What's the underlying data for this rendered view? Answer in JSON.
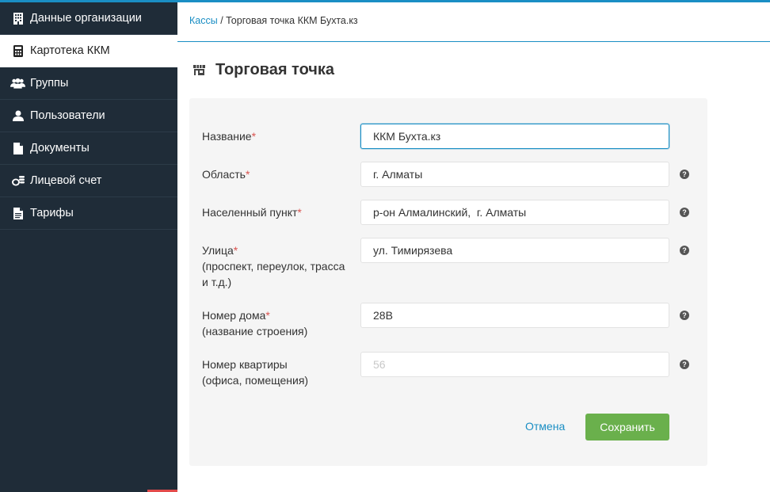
{
  "sidebar": {
    "items": [
      {
        "label": "Данные организации",
        "icon": "building-icon"
      },
      {
        "label": "Картотека ККМ",
        "icon": "calculator-icon",
        "active": true
      },
      {
        "label": "Группы",
        "icon": "users-group-icon"
      },
      {
        "label": "Пользователи",
        "icon": "user-icon"
      },
      {
        "label": "Документы",
        "icon": "document-icon"
      },
      {
        "label": "Лицевой счет",
        "icon": "coins-icon"
      },
      {
        "label": "Тарифы",
        "icon": "tariff-document-icon"
      }
    ]
  },
  "breadcrumb": {
    "link": "Кассы",
    "separator": " / ",
    "current": "Торговая точка ККМ Бухта.кз"
  },
  "page": {
    "title": "Торговая точка",
    "icon": "store-icon"
  },
  "form": {
    "name": {
      "label": "Название",
      "required": "*",
      "value": "ККМ Бухта.кз"
    },
    "region": {
      "label": "Область",
      "required": "*",
      "value": "г. Алматы"
    },
    "locality": {
      "label": "Населенный пункт",
      "required": "*",
      "value": "р-он Алмалинский,  г. Алматы"
    },
    "street": {
      "label": "Улица",
      "required": "*",
      "hint": "(проспект, переулок, трасса и т.д.)",
      "value": "ул. Тимирязева"
    },
    "house": {
      "label": "Номер дома",
      "required": "*",
      "hint": "(название строения)",
      "value": "28В"
    },
    "apartment": {
      "label": "Номер квартиры",
      "hint": "(офиса, помещения)",
      "value": "",
      "placeholder": "56"
    },
    "help_glyph": "?",
    "cancel_label": "Отмена",
    "save_label": "Сохранить"
  },
  "colors": {
    "sidebar_bg": "#1f2c38",
    "accent": "#1a8ec4",
    "save_button": "#6ab04c",
    "required": "#d9534f"
  }
}
